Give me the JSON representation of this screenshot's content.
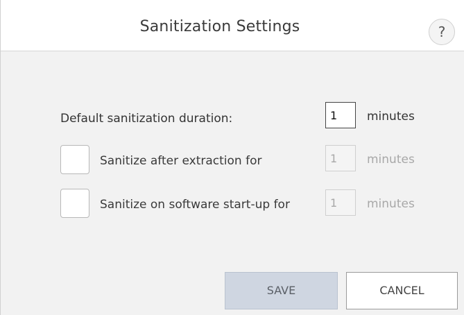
{
  "dialog": {
    "title": "Sanitization Settings",
    "help_label": "?"
  },
  "settings": {
    "default_duration": {
      "label": "Default sanitization duration:",
      "value": "1",
      "unit": "minutes"
    },
    "after_extraction": {
      "label": "Sanitize after extraction for",
      "checked": false,
      "value": "1",
      "unit": "minutes"
    },
    "on_startup": {
      "label": "Sanitize on software start-up for",
      "checked": false,
      "value": "1",
      "unit": "minutes"
    }
  },
  "buttons": {
    "save": "SAVE",
    "cancel": "CANCEL"
  },
  "colors": {
    "save_bg": "#cfd6e1",
    "body_bg": "#f2f2f2",
    "disabled_text": "#a8a8a8"
  }
}
